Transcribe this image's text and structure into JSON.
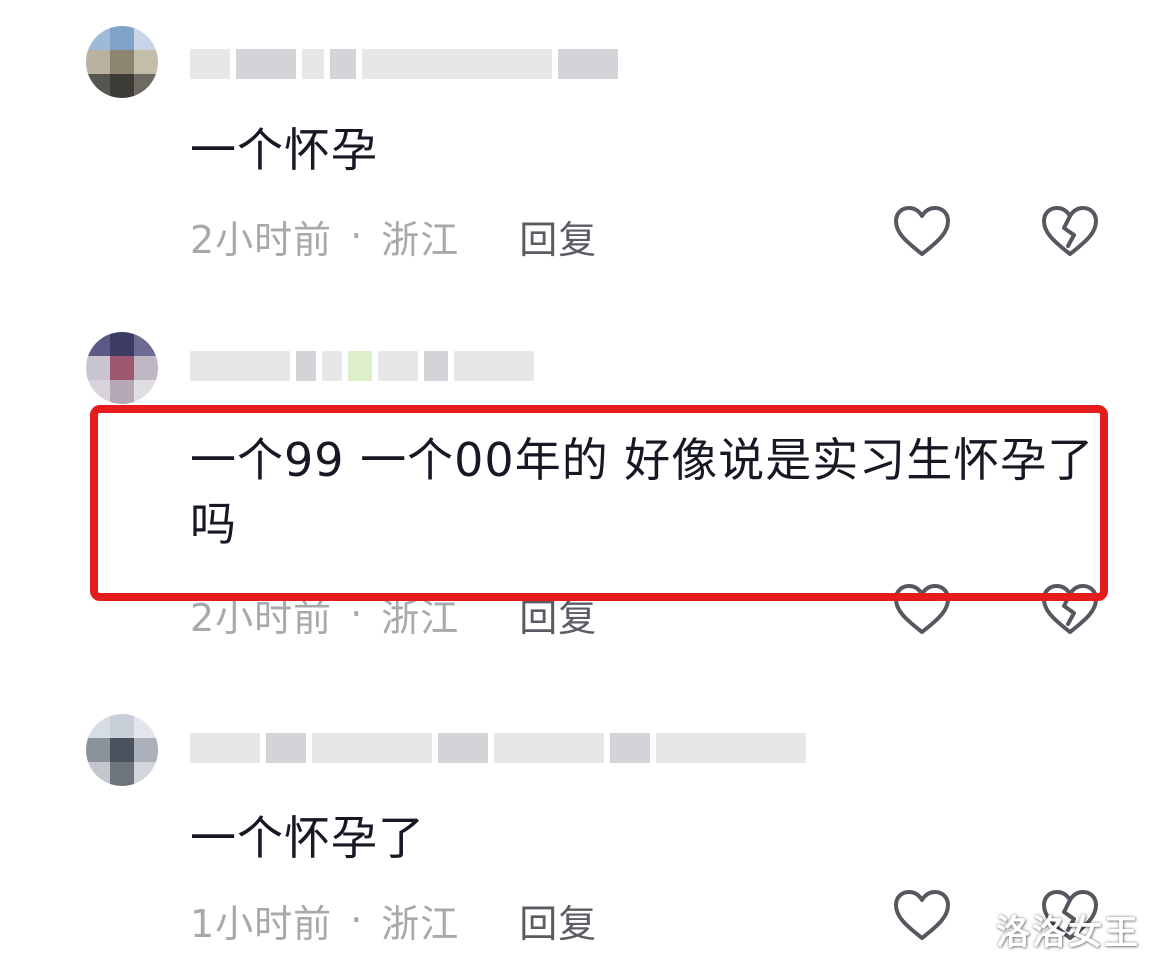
{
  "comments": [
    {
      "text": "一个怀孕",
      "time": "2小时前",
      "separator": "·",
      "location": "浙江",
      "reply_label": "回复"
    },
    {
      "text": "一个99 一个00年的 好像说是实习生怀孕了吗",
      "time": "2小时前",
      "separator": "·",
      "location": "浙江",
      "reply_label": "回复"
    },
    {
      "text": "一个怀孕了",
      "time": "1小时前",
      "separator": "·",
      "location": "浙江",
      "reply_label": "回复"
    }
  ],
  "watermark": "洛洛女王",
  "colors": {
    "highlight": "#e61b1b",
    "meta_text": "#a8a8ad",
    "reply_text": "#5b5c63"
  }
}
